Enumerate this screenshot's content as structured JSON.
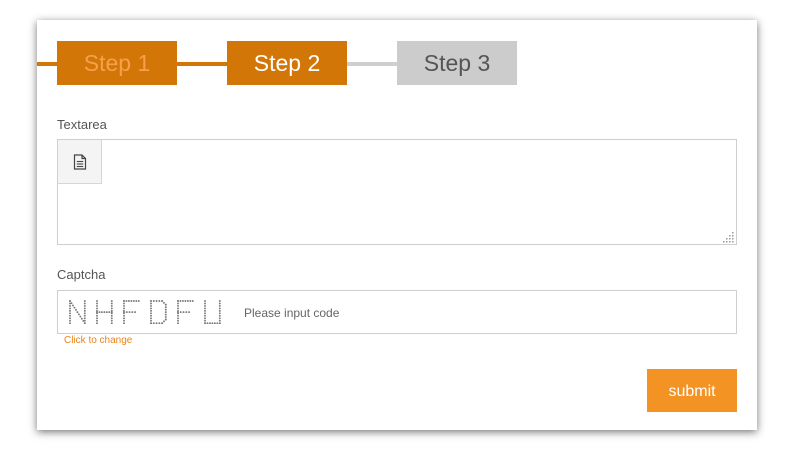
{
  "steps": [
    {
      "label": "Step 1",
      "state": "completed"
    },
    {
      "label": "Step 2",
      "state": "active"
    },
    {
      "label": "Step 3",
      "state": "pending"
    }
  ],
  "form": {
    "textarea": {
      "label": "Textarea",
      "value": "",
      "toolbar_icon": "document-icon"
    },
    "captcha": {
      "label": "Captcha",
      "code": "NHFDFU",
      "placeholder": "Please input code",
      "value": "",
      "change_link": "Click to change"
    },
    "submit_label": "submit"
  },
  "colors": {
    "accent_dark": "#d27608",
    "accent": "#f39324",
    "step1_text": "#f6a04a",
    "pending": "#cccccc"
  }
}
